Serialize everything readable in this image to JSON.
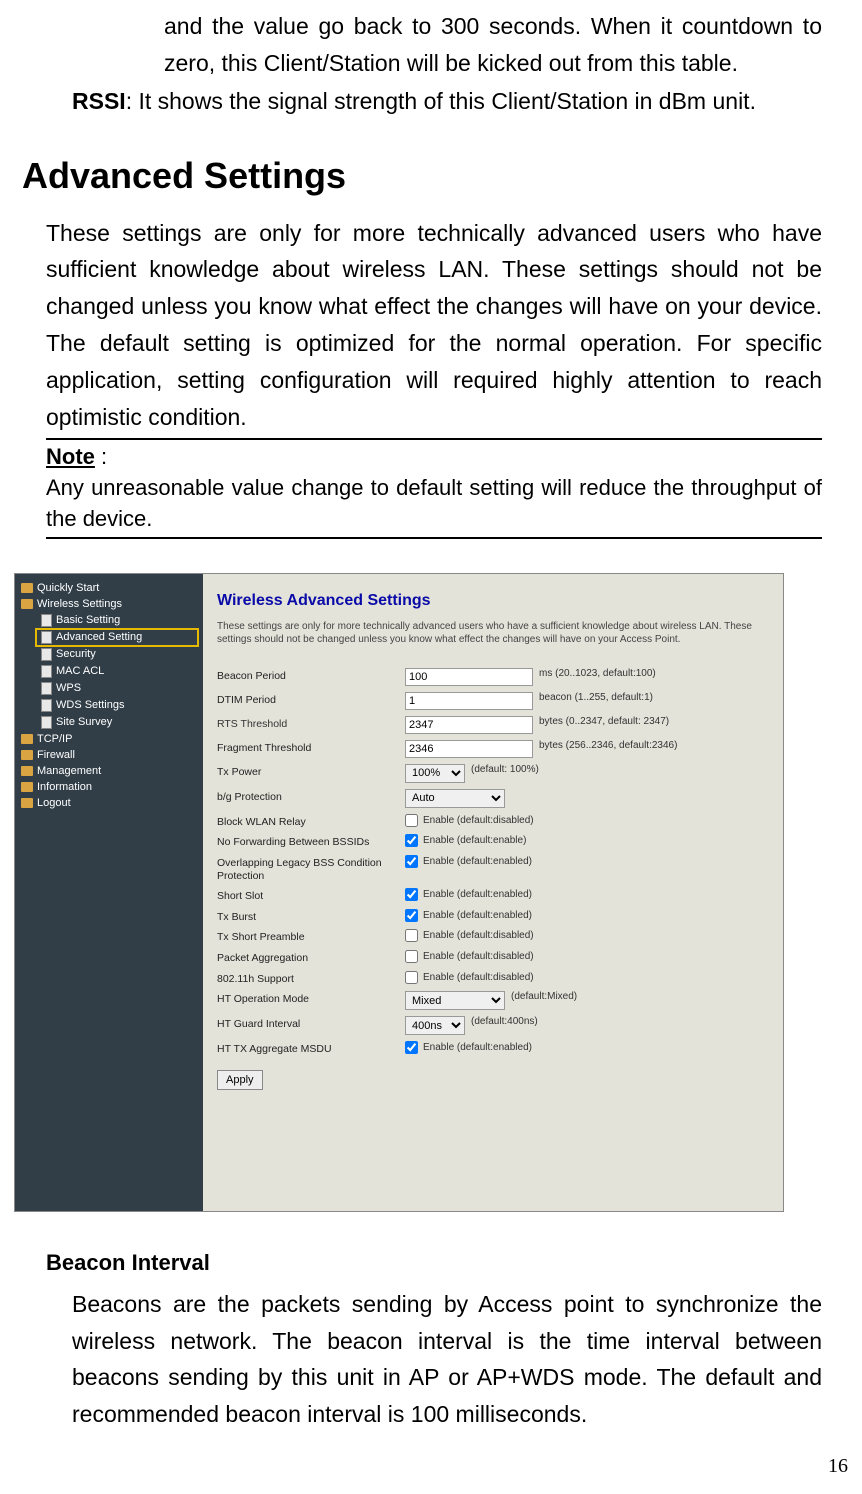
{
  "doc": {
    "intro1": "and the value go back to 300 seconds. When it countdown to zero, this Client/Station will be kicked out from this table.",
    "rssi_label": "RSSI",
    "rssi_text": ": It shows the signal strength of this Client/Station in dBm unit.",
    "heading": "Advanced Settings",
    "paragraph": "These settings are only for more technically advanced users who have sufficient knowledge about wireless LAN. These settings should not be changed unless you know what effect the changes will have on your device. The default setting is optimized for the normal operation. For specific application, setting configuration will required highly attention to reach optimistic condition.",
    "note_label": "Note",
    "note_colon": " :",
    "note_text": "Any unreasonable value change to default setting will reduce the throughput of the device.",
    "sub_heading": "Beacon Interval",
    "sub_paragraph": "Beacons are the packets sending by Access point to synchronize the wireless network. The beacon interval is the time interval between beacons sending by this unit in AP or AP+WDS mode. The default and recommended beacon interval is 100 milliseconds.",
    "page_num": "16"
  },
  "sidebar": {
    "items": [
      {
        "type": "folder",
        "label": "Quickly Start"
      },
      {
        "type": "folder",
        "label": "Wireless Settings"
      },
      {
        "type": "page",
        "label": "Basic Setting"
      },
      {
        "type": "page",
        "label": "Advanced Setting",
        "highlight": true
      },
      {
        "type": "page",
        "label": "Security"
      },
      {
        "type": "page",
        "label": "MAC ACL"
      },
      {
        "type": "page",
        "label": "WPS"
      },
      {
        "type": "page",
        "label": "WDS Settings"
      },
      {
        "type": "page",
        "label": "Site Survey"
      },
      {
        "type": "folder",
        "label": "TCP/IP"
      },
      {
        "type": "folder",
        "label": "Firewall"
      },
      {
        "type": "folder",
        "label": "Management"
      },
      {
        "type": "folder",
        "label": "Information"
      },
      {
        "type": "folder",
        "label": "Logout"
      }
    ]
  },
  "panel": {
    "title": "Wireless Advanced Settings",
    "desc": "These settings are only for more technically advanced users who have a sufficient knowledge about wireless LAN. These settings should not be changed unless you know what effect the changes will have on your Access Point.",
    "rows": {
      "beacon": {
        "label": "Beacon Period",
        "value": "100",
        "hint": "ms (20..1023, default:100)"
      },
      "dtim": {
        "label": "DTIM Period",
        "value": "1",
        "hint": "beacon (1..255, default:1)"
      },
      "rts": {
        "label": "RTS Threshold",
        "value": "2347",
        "hint": "bytes (0..2347, default: 2347)"
      },
      "frag": {
        "label": "Fragment Threshold",
        "value": "2346",
        "hint": "bytes (256..2346, default:2346)"
      },
      "txpower": {
        "label": "Tx Power",
        "value": "100%",
        "hint": "(default: 100%)"
      },
      "bgprot": {
        "label": "b/g Protection",
        "value": "Auto"
      },
      "block": {
        "label": "Block WLAN Relay",
        "hint": "Enable (default:disabled)"
      },
      "nofwd": {
        "label": "No Forwarding Between BSSIDs",
        "hint": "Enable (default:enable)"
      },
      "overlap": {
        "label": "Overlapping Legacy BSS Condition Protection",
        "hint": "Enable (default:enabled)"
      },
      "short": {
        "label": "Short Slot",
        "hint": "Enable (default:enabled)"
      },
      "txburst": {
        "label": "Tx Burst",
        "hint": "Enable (default:enabled)"
      },
      "txshort": {
        "label": "Tx Short Preamble",
        "hint": "Enable (default:disabled)"
      },
      "packet": {
        "label": "Packet Aggregation",
        "hint": "Enable (default:disabled)"
      },
      "h802": {
        "label": "802.11h Support",
        "hint": "Enable (default:disabled)"
      },
      "htop": {
        "label": "HT Operation Mode",
        "value": "Mixed",
        "hint": "(default:Mixed)"
      },
      "htguard": {
        "label": "HT Guard Interval",
        "value": "400ns",
        "hint": "(default:400ns)"
      },
      "httx": {
        "label": "HT TX Aggregate MSDU",
        "hint": "Enable (default:enabled)"
      }
    },
    "apply": "Apply"
  }
}
